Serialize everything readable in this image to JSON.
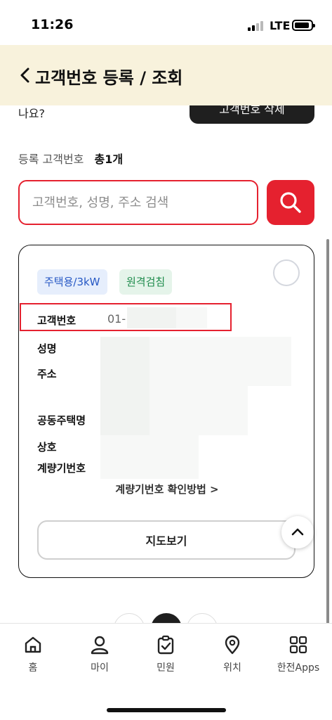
{
  "status_bar": {
    "time": "11:26",
    "network": "LTE"
  },
  "header": {
    "title": "고객번호 등록 / 조회"
  },
  "top_partial": {
    "question_text": "나요?",
    "button_label": "고객번호 삭제"
  },
  "registered": {
    "label": "등록 고객번호",
    "count": "총1개"
  },
  "search": {
    "placeholder": "고객번호, 성명, 주소 검색"
  },
  "card": {
    "badges": {
      "type": "주택용/3kW",
      "remote": "원격검침"
    },
    "fields": {
      "customer_number_label": "고객번호",
      "customer_number_value": "01-",
      "name_label": "성명",
      "address_label": "주소",
      "apartment_label": "공동주택명",
      "business_label": "상호",
      "meter_label": "계량기번호"
    },
    "meter_help_link": "계량기번호 확인방법 >",
    "map_button": "지도보기"
  },
  "tabbar": {
    "items": [
      {
        "label": "홈",
        "icon": "home-icon"
      },
      {
        "label": "마이",
        "icon": "person-icon"
      },
      {
        "label": "민원",
        "icon": "clipboard-check-icon"
      },
      {
        "label": "위치",
        "icon": "location-pin-icon"
      },
      {
        "label": "한전Apps",
        "icon": "apps-grid-icon"
      }
    ]
  },
  "colors": {
    "accent": "#e5212f",
    "header_bg": "#f8f2dc",
    "badge_blue": "#2557c4",
    "badge_green": "#1c8a4a"
  }
}
